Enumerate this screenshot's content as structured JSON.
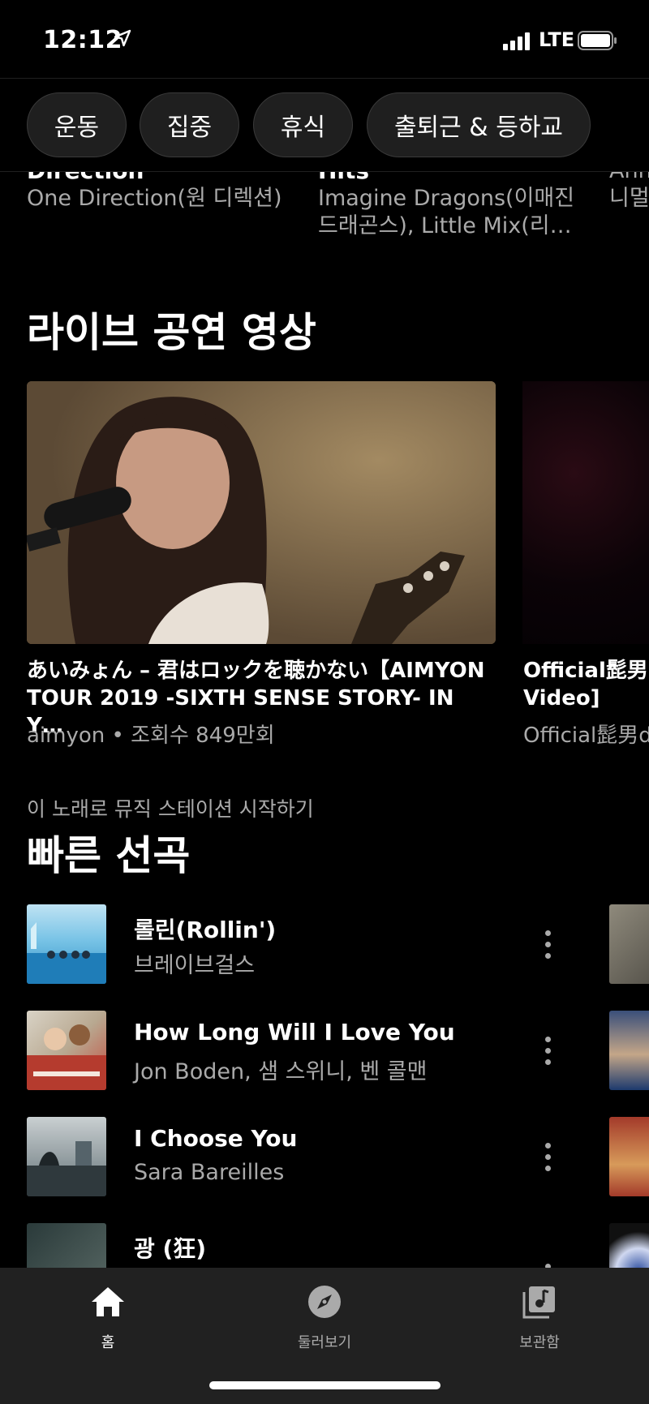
{
  "status": {
    "time": "12:12",
    "network": "LTE"
  },
  "chips": [
    "운동",
    "집중",
    "휴식",
    "출퇴근 & 등하교"
  ],
  "top_cards": [
    {
      "title": "Direction",
      "subtitle": "One Direction(원 디렉션)"
    },
    {
      "title": "Hits",
      "subtitle_line1": "Imagine Dragons(이매진",
      "subtitle_line2": "드래곤스), Little Mix(리…"
    },
    {
      "title": "Ann",
      "subtitle": "니멀"
    }
  ],
  "live": {
    "heading": "라이브 공연 영상",
    "videos": [
      {
        "title_line1": "あいみょん – 君はロックを聴かない【AIMYON",
        "title_line2": "TOUR 2019 -SIXTH SENSE STORY- IN Y…",
        "channel": "aimyon",
        "views": "조회수 849만회"
      },
      {
        "title_line1": "Official髭男",
        "title_line2": "Video]",
        "meta": "Official髭男d"
      }
    ]
  },
  "quick_picks": {
    "subheading": "이 노래로 뮤직 스테이션 시작하기",
    "heading": "빠른 선곡",
    "items": [
      {
        "title": "롤린(Rollin')",
        "artist": "브레이브걸스"
      },
      {
        "title": "How Long Will I Love You",
        "artist": "Jon Boden, 샘 스위니, 벤 콜맨"
      },
      {
        "title": "I Choose You",
        "artist": "Sara Bareilles"
      },
      {
        "title": "광 (狂)",
        "artist": ""
      }
    ]
  },
  "nav": {
    "home": "홈",
    "explore": "둘러보기",
    "library": "보관함"
  }
}
